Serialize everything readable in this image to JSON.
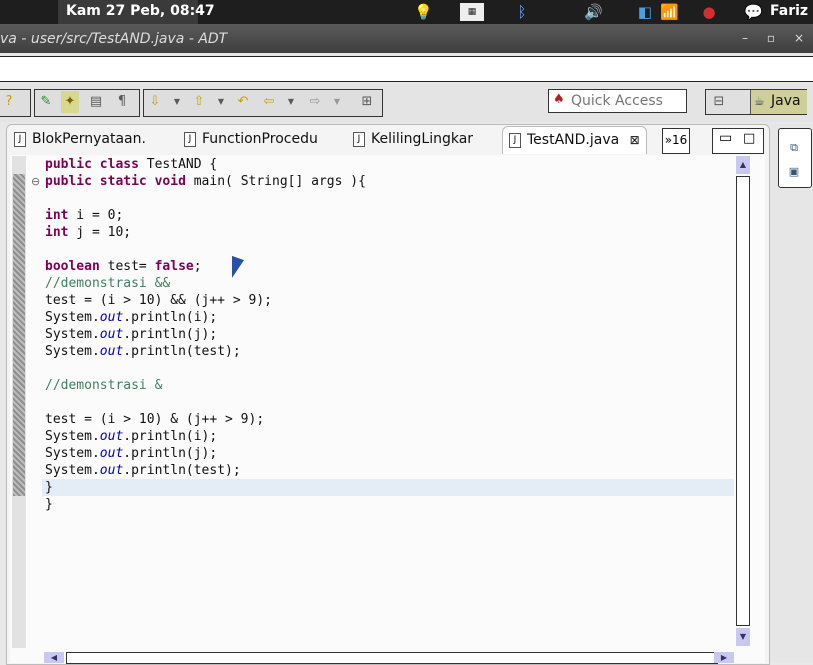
{
  "top_panel": {
    "clock": "Kam 27 Peb, 08:47",
    "username": "Fariz",
    "icons": [
      "bulb-icon",
      "keyboard-indicator-icon",
      "bluetooth-icon",
      "volume-icon",
      "network-icon",
      "wifi-icon",
      "update-icon",
      "chat-icon"
    ]
  },
  "window": {
    "title": "va - user/src/TestAND.java - ADT",
    "minimize": "–",
    "maximize": "▫",
    "close": "×"
  },
  "toolbar": {
    "quick_access_placeholder": "Quick Access",
    "perspective_label": "Java"
  },
  "editor": {
    "tabs": [
      {
        "label": "BlokPernyataan."
      },
      {
        "label": "FunctionProcedu"
      },
      {
        "label": "KelilingLingkar"
      },
      {
        "label": "TestAND.java",
        "active": true
      }
    ],
    "overflow_count": "»16",
    "code_lines": [
      "public class TestAND {",
      "public static void main( String[] args ){",
      "",
      "int i = 0;",
      "int j = 10;",
      "",
      "boolean test= false;",
      "//demonstrasi &&",
      "test = (i > 10) && (j++ > 9);",
      "System.out.println(i);",
      "System.out.println(j);",
      "System.out.println(test);",
      "",
      "//demonstrasi &",
      "",
      "test = (i > 10) & (j++ > 9);",
      "System.out.println(i);",
      "System.out.println(j);",
      "System.out.println(test);",
      "}",
      "}"
    ]
  },
  "colors": {
    "keyword": "#7f0055",
    "comment": "#3f7f5f",
    "field": "#0000c0",
    "current_line": "#e4ecf6"
  }
}
